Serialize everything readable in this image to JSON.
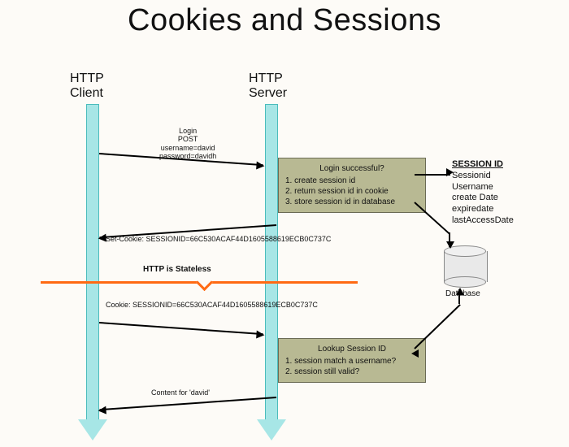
{
  "title": "Cookies and Sessions",
  "client_label": "HTTP\nClient",
  "server_label": "HTTP\nServer",
  "login_req": "Login\nPOST\nusername=david\npassword=davidh",
  "login_box": {
    "title": "Login successful?",
    "s1": "1. create session id",
    "s2": "2. return session id in cookie",
    "s3": "3. store session id in database"
  },
  "set_cookie": "Set-Cookie: SESSIONID=66C530ACAF44D1605588619ECB0C737C",
  "stateless": "HTTP is Stateless",
  "cookie_req": "Cookie: SESSIONID=66C530ACAF44D1605588619ECB0C737C",
  "lookup_box": {
    "title": "Lookup Session ID",
    "s1": "1. session match a username?",
    "s2": "2. session still valid?"
  },
  "content_resp": "Content for 'david'",
  "session_table": {
    "header": "SESSION ID",
    "f1": "Sessionid",
    "f2": "Username",
    "f3": "create Date",
    "f4": "expiredate",
    "f5": "lastAccessDate"
  },
  "db_label": "Database"
}
